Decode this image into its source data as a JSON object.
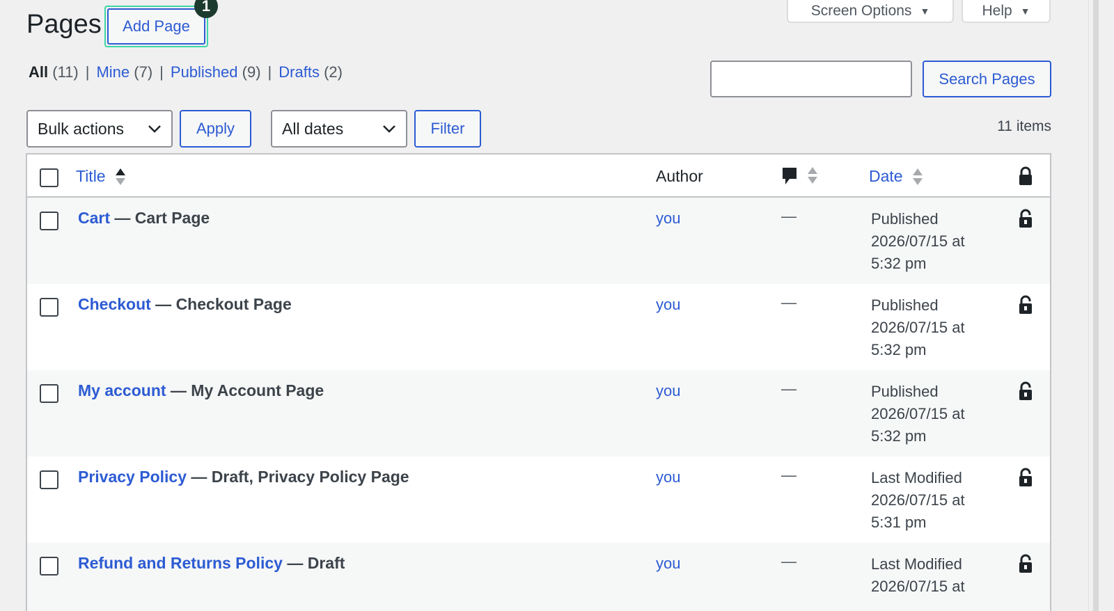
{
  "header": {
    "title": "Pages",
    "add_page_label": "Add Page",
    "badge_number": "1",
    "screen_options_label": "Screen Options",
    "help_label": "Help"
  },
  "filters": {
    "all": {
      "label": "All",
      "count": "(11)"
    },
    "mine": {
      "label": "Mine",
      "count": "(7)"
    },
    "published": {
      "label": "Published",
      "count": "(9)"
    },
    "drafts": {
      "label": "Drafts",
      "count": "(2)"
    },
    "separator": "|"
  },
  "search": {
    "value": "",
    "button_label": "Search Pages"
  },
  "tablenav": {
    "bulk_actions": "Bulk actions",
    "apply_label": "Apply",
    "dates": "All dates",
    "filter_label": "Filter",
    "items_count": "11 items"
  },
  "table": {
    "columns": {
      "title": "Title",
      "author": "Author",
      "date": "Date"
    },
    "rows": [
      {
        "title": "Cart",
        "state": " — Cart Page",
        "author": "you",
        "comments": "—",
        "status": "Published",
        "date": "2026/07/15 at",
        "time": "5:32 pm"
      },
      {
        "title": "Checkout",
        "state": " — Checkout Page",
        "author": "you",
        "comments": "—",
        "status": "Published",
        "date": "2026/07/15 at",
        "time": "5:32 pm"
      },
      {
        "title": "My account",
        "state": " — My Account Page",
        "author": "you",
        "comments": "—",
        "status": "Published",
        "date": "2026/07/15 at",
        "time": "5:32 pm"
      },
      {
        "title": "Privacy Policy",
        "state": " — Draft, Privacy Policy Page",
        "author": "you",
        "comments": "—",
        "status": "Last Modified",
        "date": "2026/07/15 at",
        "time": "5:31 pm"
      },
      {
        "title": "Refund and Returns Policy",
        "state": " — Draft",
        "author": "you",
        "comments": "—",
        "status": "Last Modified",
        "date": "2026/07/15 at",
        "time": ""
      }
    ]
  },
  "icons": {
    "comment": "comment-bubble-icon",
    "lock_header": "lock-icon",
    "lock_row": "unlock-icon",
    "chevron": "chevron-down-icon",
    "triangle": "triangle-down-icon"
  }
}
